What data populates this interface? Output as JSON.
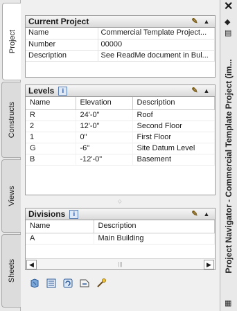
{
  "tabs": [
    {
      "label": "Project",
      "active": true
    },
    {
      "label": "Constructs",
      "active": false
    },
    {
      "label": "Views",
      "active": false
    },
    {
      "label": "Sheets",
      "active": false
    }
  ],
  "current_project": {
    "title": "Current Project",
    "rows": [
      {
        "key": "Name",
        "value": "Commercial Template Project..."
      },
      {
        "key": "Number",
        "value": "00000"
      },
      {
        "key": "Description",
        "value": "See ReadMe document in Bul..."
      }
    ]
  },
  "levels": {
    "title": "Levels",
    "columns": [
      "Name",
      "Elevation",
      "Description"
    ],
    "rows": [
      [
        "R",
        "24'-0\"",
        "Roof"
      ],
      [
        "2",
        "12'-0\"",
        "Second Floor"
      ],
      [
        "1",
        "0\"",
        "First Floor"
      ],
      [
        "G",
        "-6\"",
        "Site Datum Level"
      ],
      [
        "B",
        "-12'-0\"",
        "Basement"
      ]
    ]
  },
  "divisions": {
    "title": "Divisions",
    "columns": [
      "Name",
      "Description"
    ],
    "rows": [
      [
        "A",
        "Main Building"
      ]
    ]
  },
  "palette_title": "Project Navigator - Commercial Template Project (im...",
  "toolbar_icons": [
    "refresh-icon",
    "project-browser-icon",
    "reload-icon",
    "repath-icon",
    "wizard-icon"
  ],
  "colors": {
    "accent": "#1f4f9b",
    "header_bg": "#d9d9d9"
  }
}
